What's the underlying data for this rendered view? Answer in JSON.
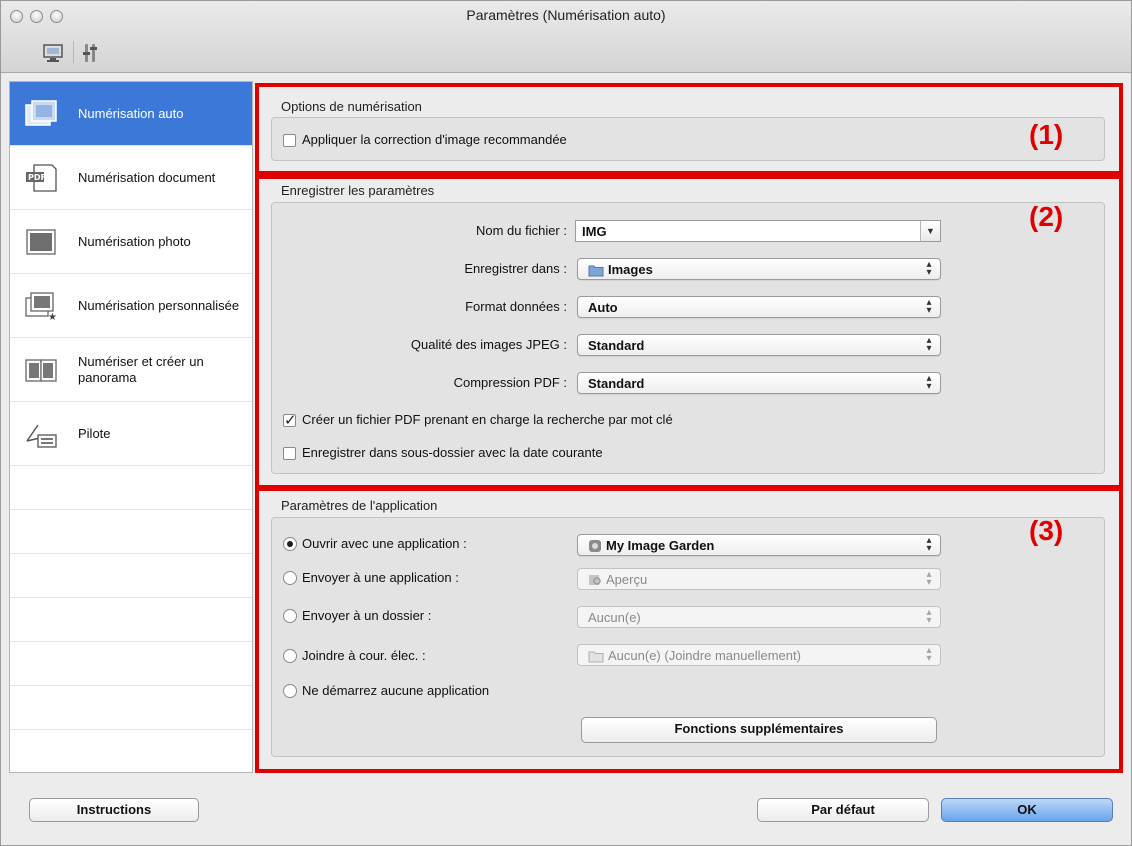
{
  "window": {
    "title": "Paramètres (Numérisation auto)"
  },
  "sidebar": {
    "items": [
      {
        "label": "Numérisation auto",
        "selected": true
      },
      {
        "label": "Numérisation document"
      },
      {
        "label": "Numérisation photo"
      },
      {
        "label": "Numérisation personnalisée"
      },
      {
        "label": "Numériser et créer un panorama"
      },
      {
        "label": "Pilote"
      }
    ]
  },
  "section1": {
    "title": "Options de numérisation",
    "marker": "(1)",
    "apply_correction_label": "Appliquer la correction d'image recommandée",
    "apply_correction_checked": false
  },
  "section2": {
    "title": "Enregistrer les paramètres",
    "marker": "(2)",
    "file_name_label": "Nom du fichier :",
    "file_name_value": "IMG",
    "save_in_label": "Enregistrer dans :",
    "save_in_value": "Images",
    "data_format_label": "Format données :",
    "data_format_value": "Auto",
    "jpeg_quality_label": "Qualité des images JPEG :",
    "jpeg_quality_value": "Standard",
    "pdf_compression_label": "Compression PDF :",
    "pdf_compression_value": "Standard",
    "searchable_pdf_label": "Créer un fichier PDF prenant en charge la recherche par mot clé",
    "searchable_pdf_checked": true,
    "subfolder_label": "Enregistrer dans sous-dossier avec la date courante",
    "subfolder_checked": false
  },
  "section3": {
    "title": "Paramètres de l'application",
    "marker": "(3)",
    "open_app_label": "Ouvrir avec une application :",
    "open_app_value": "My Image Garden",
    "send_app_label": "Envoyer à une application :",
    "send_app_value": "Aperçu",
    "send_folder_label": "Envoyer à un dossier :",
    "send_folder_value": "Aucun(e)",
    "attach_email_label": "Joindre à cour. élec. :",
    "attach_email_value": "Aucun(e) (Joindre manuellement)",
    "no_app_label": "Ne démarrez aucune application",
    "selected_option": "open_app",
    "more_functions_label": "Fonctions supplémentaires"
  },
  "footer": {
    "instructions_label": "Instructions",
    "defaults_label": "Par défaut",
    "ok_label": "OK"
  },
  "colors": {
    "selection": "#3b78d8",
    "highlight_red": "#e00000",
    "default_button": "#6aa3ec"
  }
}
